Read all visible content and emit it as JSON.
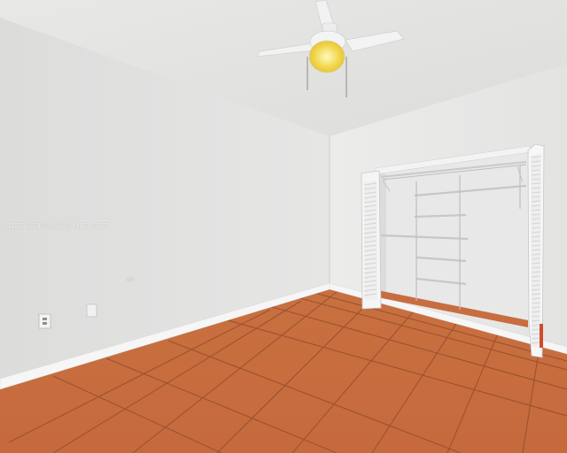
{
  "photo": {
    "watermark": "A11724668 © Miami MLS 2025"
  },
  "colors": {
    "ceiling": "#e6e6e4",
    "left_wall": "#e1e1e0",
    "back_wall": "#ececeb",
    "floor_tile": "#c4683f",
    "grout": "#8a4a2e",
    "baseboard": "#f7f7f7",
    "closet_interior": "#e9e9e9",
    "shutter_door": "#f5f5f5",
    "fan_light": "#f3dd5a"
  },
  "objects": {
    "ceiling_fan": "ceiling-fan",
    "closet": "open-closet-with-wire-shelves",
    "doors": "louvered-bifold-doors",
    "outlet": "wall-outlet",
    "switch_plate": "wall-plate"
  }
}
